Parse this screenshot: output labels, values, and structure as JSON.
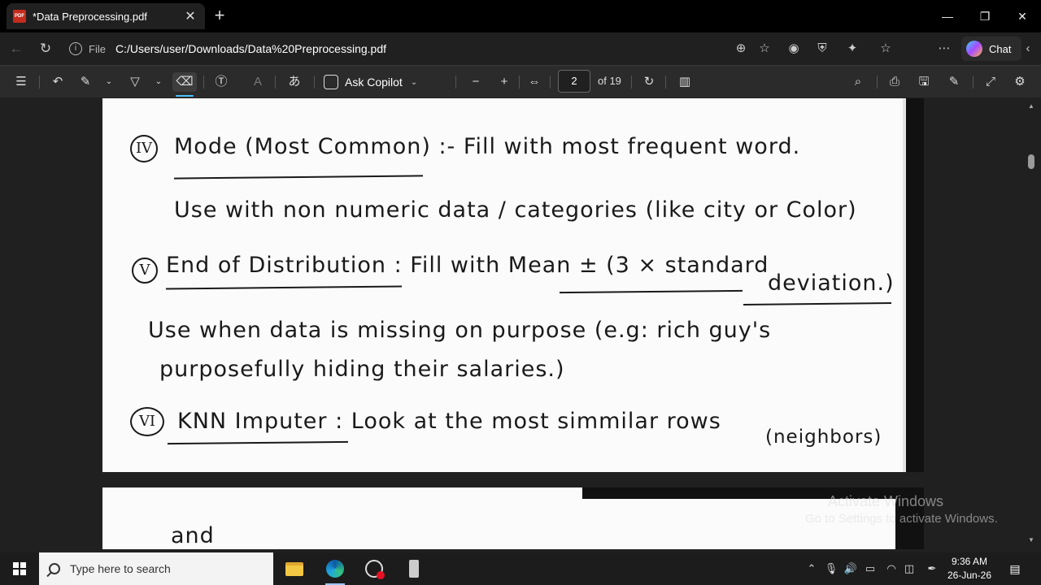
{
  "browser": {
    "tab_title": "*Data Preprocessing.pdf",
    "tab_badge": "PDF",
    "new_tab": "+",
    "scheme_label": "File",
    "url": "C:/Users/user/Downloads/Data%20Preprocessing.pdf",
    "chat_label": "Chat"
  },
  "toolbar": {
    "ask_copilot": "Ask Copilot",
    "page_number": "2",
    "page_of": "of 19"
  },
  "document": {
    "line1_marker": "IV",
    "line1_text": "Mode (Most Common) :- Fill with most frequent word.",
    "line2_text": "Use with non numeric data / categories (like city or Color)",
    "line3_marker": "V",
    "line3_text": "End of Distribution : Fill with Mean ± (3 × standard",
    "line3_cont": "deviation.)",
    "line4_text": "Use when data is missing on purpose (e.g: rich guy's",
    "line5_text": "purposefully hiding their salaries.)",
    "line6_marker": "VI",
    "line6_text": "KNN Imputer : Look at the most simmilar rows",
    "line6_cont": "(neighbors)",
    "page2_text": "and"
  },
  "watermark": {
    "line1": "Activate Windows",
    "line2": "Go to Settings to activate Windows."
  },
  "taskbar": {
    "search_placeholder": "Type here to search",
    "time": "9:36 AM",
    "date": "26-Jun-26"
  }
}
